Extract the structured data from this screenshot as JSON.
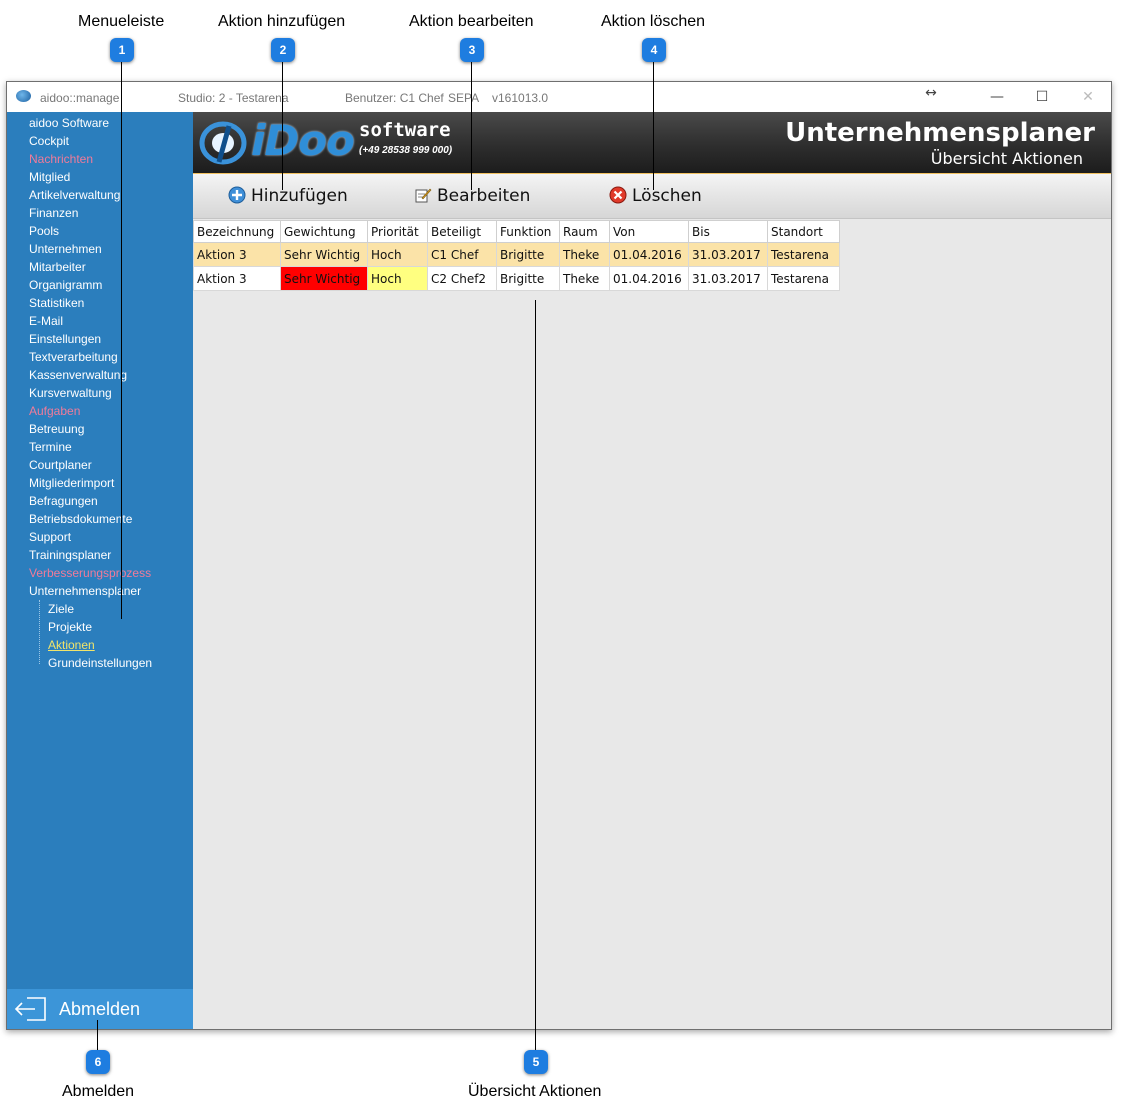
{
  "callouts": [
    {
      "num": "1",
      "label": "Menueleiste"
    },
    {
      "num": "2",
      "label": "Aktion hinzufügen"
    },
    {
      "num": "3",
      "label": "Aktion bearbeiten"
    },
    {
      "num": "4",
      "label": "Aktion löschen"
    },
    {
      "num": "5",
      "label": "Übersicht Aktionen"
    },
    {
      "num": "6",
      "label": "Abmelden"
    }
  ],
  "titlebar": {
    "app": "aidoo::manage",
    "studio": "Studio: 2 - Testarena",
    "user": "Benutzer: C1 Chef",
    "sepa": "SEPA",
    "version": "v161013.0"
  },
  "sidebar": {
    "items": [
      {
        "label": "aidoo Software",
        "color": "white"
      },
      {
        "label": "Cockpit",
        "color": "white"
      },
      {
        "label": "Nachrichten",
        "color": "pink"
      },
      {
        "label": "Mitglied",
        "color": "white"
      },
      {
        "label": "Artikelverwaltung",
        "color": "white"
      },
      {
        "label": "Finanzen",
        "color": "white"
      },
      {
        "label": "Pools",
        "color": "white"
      },
      {
        "label": "Unternehmen",
        "color": "white"
      },
      {
        "label": "Mitarbeiter",
        "color": "white"
      },
      {
        "label": "Organigramm",
        "color": "white"
      },
      {
        "label": "Statistiken",
        "color": "white"
      },
      {
        "label": "E-Mail",
        "color": "white"
      },
      {
        "label": "Einstellungen",
        "color": "white"
      },
      {
        "label": "Textverarbeitung",
        "color": "white"
      },
      {
        "label": "Kassenverwaltung",
        "color": "white"
      },
      {
        "label": "Kursverwaltung",
        "color": "white"
      },
      {
        "label": "Aufgaben",
        "color": "pink"
      },
      {
        "label": "Betreuung",
        "color": "white"
      },
      {
        "label": "Termine",
        "color": "white"
      },
      {
        "label": "Courtplaner",
        "color": "white"
      },
      {
        "label": "Mitgliederimport",
        "color": "white"
      },
      {
        "label": "Befragungen",
        "color": "white"
      },
      {
        "label": "Betriebsdokumente",
        "color": "white"
      },
      {
        "label": "Support",
        "color": "white"
      },
      {
        "label": "Trainingsplaner",
        "color": "white"
      },
      {
        "label": "Verbesserungsprozess",
        "color": "pink"
      },
      {
        "label": "Unternehmensplaner",
        "color": "white"
      }
    ],
    "subitems": [
      {
        "label": "Ziele",
        "active": false
      },
      {
        "label": "Projekte",
        "active": false
      },
      {
        "label": "Aktionen",
        "active": true
      },
      {
        "label": "Grundeinstellungen",
        "active": false
      }
    ],
    "logout_label": "Abmelden"
  },
  "banner": {
    "logo_text": "iDoo",
    "software": "software",
    "phone": "(+49 28538 999 000)",
    "title": "Unternehmensplaner",
    "subtitle": "Übersicht Aktionen"
  },
  "toolbar": {
    "add_label": "Hinzufügen",
    "edit_label": "Bearbeiten",
    "delete_label": "Löschen"
  },
  "table": {
    "columns": [
      "Bezeichnung",
      "Gewichtung",
      "Priorität",
      "Beteiligt",
      "Funktion",
      "Raum",
      "Von",
      "Bis",
      "Standort"
    ],
    "rows": [
      {
        "cells": [
          "Aktion 3",
          "Sehr Wichtig",
          "Hoch",
          "C1 Chef",
          "Brigitte",
          "Theke",
          "01.04.2016",
          "31.03.2017",
          "Testarena"
        ],
        "selected": true
      },
      {
        "cells": [
          "Aktion 3",
          "Sehr Wichtig",
          "Hoch",
          "C2 Chef2",
          "Brigitte",
          "Theke",
          "01.04.2016",
          "31.03.2017",
          "Testarena"
        ],
        "selected": false
      }
    ]
  },
  "colors": {
    "sidebar": "#2b7ebd",
    "accent_pink": "#f07b9a",
    "badge": "#1e7de0",
    "selected_row": "#fbe3a8",
    "weight_high": "#ff0000",
    "priority_high": "#ffff80"
  }
}
